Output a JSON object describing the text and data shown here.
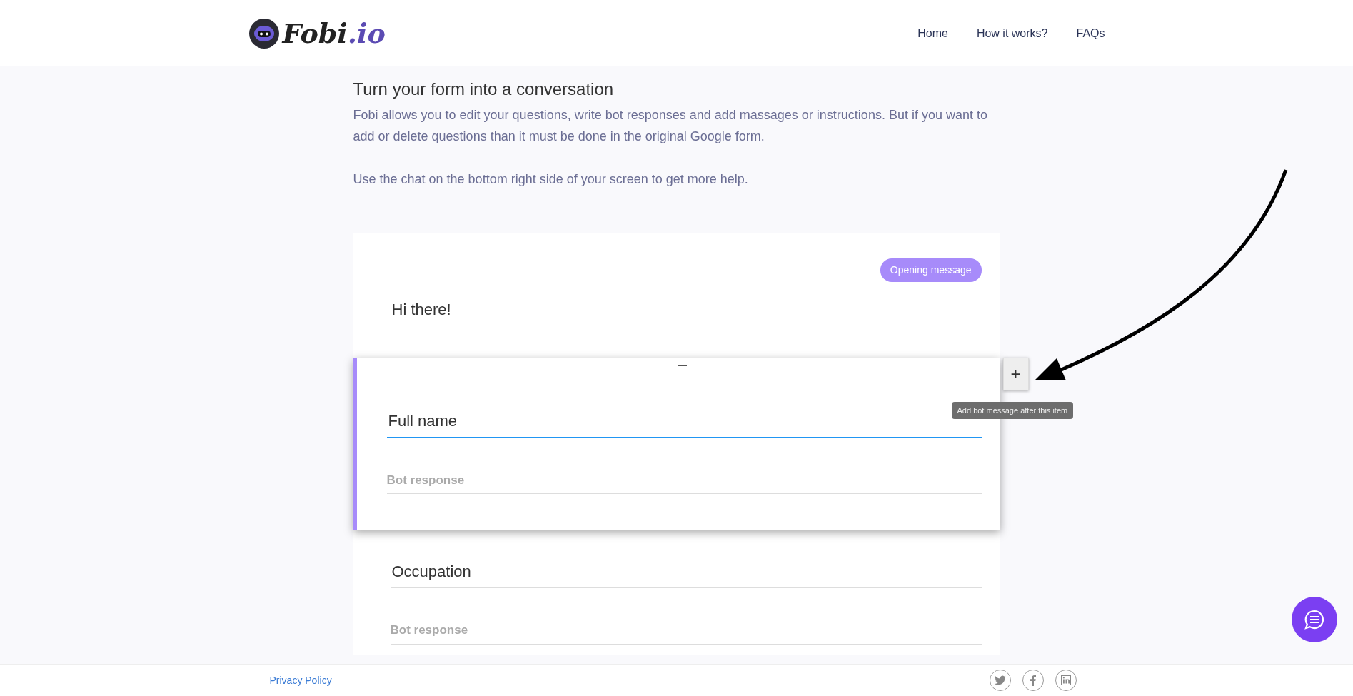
{
  "header": {
    "logo": {
      "text": "Fobi",
      "suffix": ".io"
    },
    "nav": [
      {
        "label": "Home"
      },
      {
        "label": "How it works?"
      },
      {
        "label": "FAQs"
      }
    ]
  },
  "intro": {
    "title": "Turn your form into a conversation",
    "paragraphs": [
      "Fobi allows you to edit your questions, write bot responses and add massages or instructions. But if you want to add or delete questions than it must be done in the original Google form.",
      "Use the chat on the bottom right side of your screen to get more help."
    ]
  },
  "items": [
    {
      "kind": "opening",
      "badge": "Opening message",
      "value": "Hi there!",
      "selected": false
    },
    {
      "kind": "question",
      "value": "Full name",
      "bot_response_placeholder": "Bot response",
      "selected": true,
      "add_button": {
        "label": "+",
        "tooltip": "Add bot message after this item"
      }
    },
    {
      "kind": "question",
      "value": "Occupation",
      "bot_response_placeholder": "Bot response",
      "selected": false
    }
  ],
  "footer": {
    "link": "Privacy Policy"
  }
}
